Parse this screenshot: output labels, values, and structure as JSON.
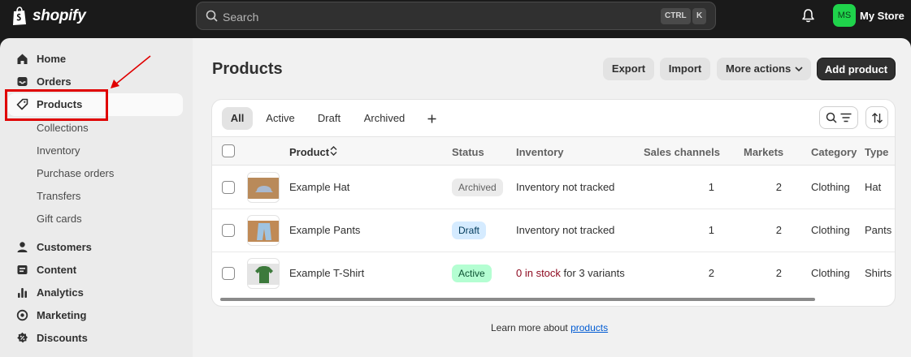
{
  "topbar": {
    "brand": "shopify",
    "search_placeholder": "Search",
    "shortcut_keys": [
      "CTRL",
      "K"
    ],
    "avatar_initials": "MS",
    "avatar_color": "#1fd34b",
    "store_name": "My Store"
  },
  "sidebar": {
    "main_items": [
      {
        "label": "Home",
        "icon": "home-icon"
      },
      {
        "label": "Orders",
        "icon": "inbox-icon"
      },
      {
        "label": "Products",
        "icon": "tag-icon",
        "active": true
      }
    ],
    "product_sub_items": [
      "Collections",
      "Inventory",
      "Purchase orders",
      "Transfers",
      "Gift cards"
    ],
    "more_items": [
      {
        "label": "Customers",
        "icon": "person-icon"
      },
      {
        "label": "Content",
        "icon": "content-icon"
      },
      {
        "label": "Analytics",
        "icon": "bar-chart-icon"
      },
      {
        "label": "Marketing",
        "icon": "target-icon"
      },
      {
        "label": "Discounts",
        "icon": "discount-icon"
      }
    ]
  },
  "page": {
    "title": "Products",
    "export_label": "Export",
    "import_label": "Import",
    "more_actions_label": "More actions",
    "add_product_label": "Add product"
  },
  "tabs": [
    "All",
    "Active",
    "Draft",
    "Archived"
  ],
  "table": {
    "columns": [
      "Product",
      "Status",
      "Inventory",
      "Sales channels",
      "Markets",
      "Category",
      "Type"
    ],
    "rows": [
      {
        "name": "Example Hat",
        "status": "Archived",
        "inventory_text": "Inventory not tracked",
        "inventory_alert": "",
        "sales_channels": "1",
        "markets": "2",
        "category": "Clothing",
        "type": "Hat"
      },
      {
        "name": "Example Pants",
        "status": "Draft",
        "inventory_text": "Inventory not tracked",
        "inventory_alert": "",
        "sales_channels": "1",
        "markets": "2",
        "category": "Clothing",
        "type": "Pants"
      },
      {
        "name": "Example T-Shirt",
        "status": "Active",
        "inventory_text": "for 3 variants",
        "inventory_alert": "0 in stock",
        "sales_channels": "2",
        "markets": "2",
        "category": "Clothing",
        "type": "Shirts"
      }
    ]
  },
  "footer": {
    "text": "Learn more about",
    "link": "products"
  },
  "colors": {
    "annotation_red": "#e00000",
    "archived_badge": "#ebebeb",
    "draft_badge": "#d5ebff",
    "active_badge": "#b4fed2",
    "stock_alert": "#8e0b21"
  }
}
